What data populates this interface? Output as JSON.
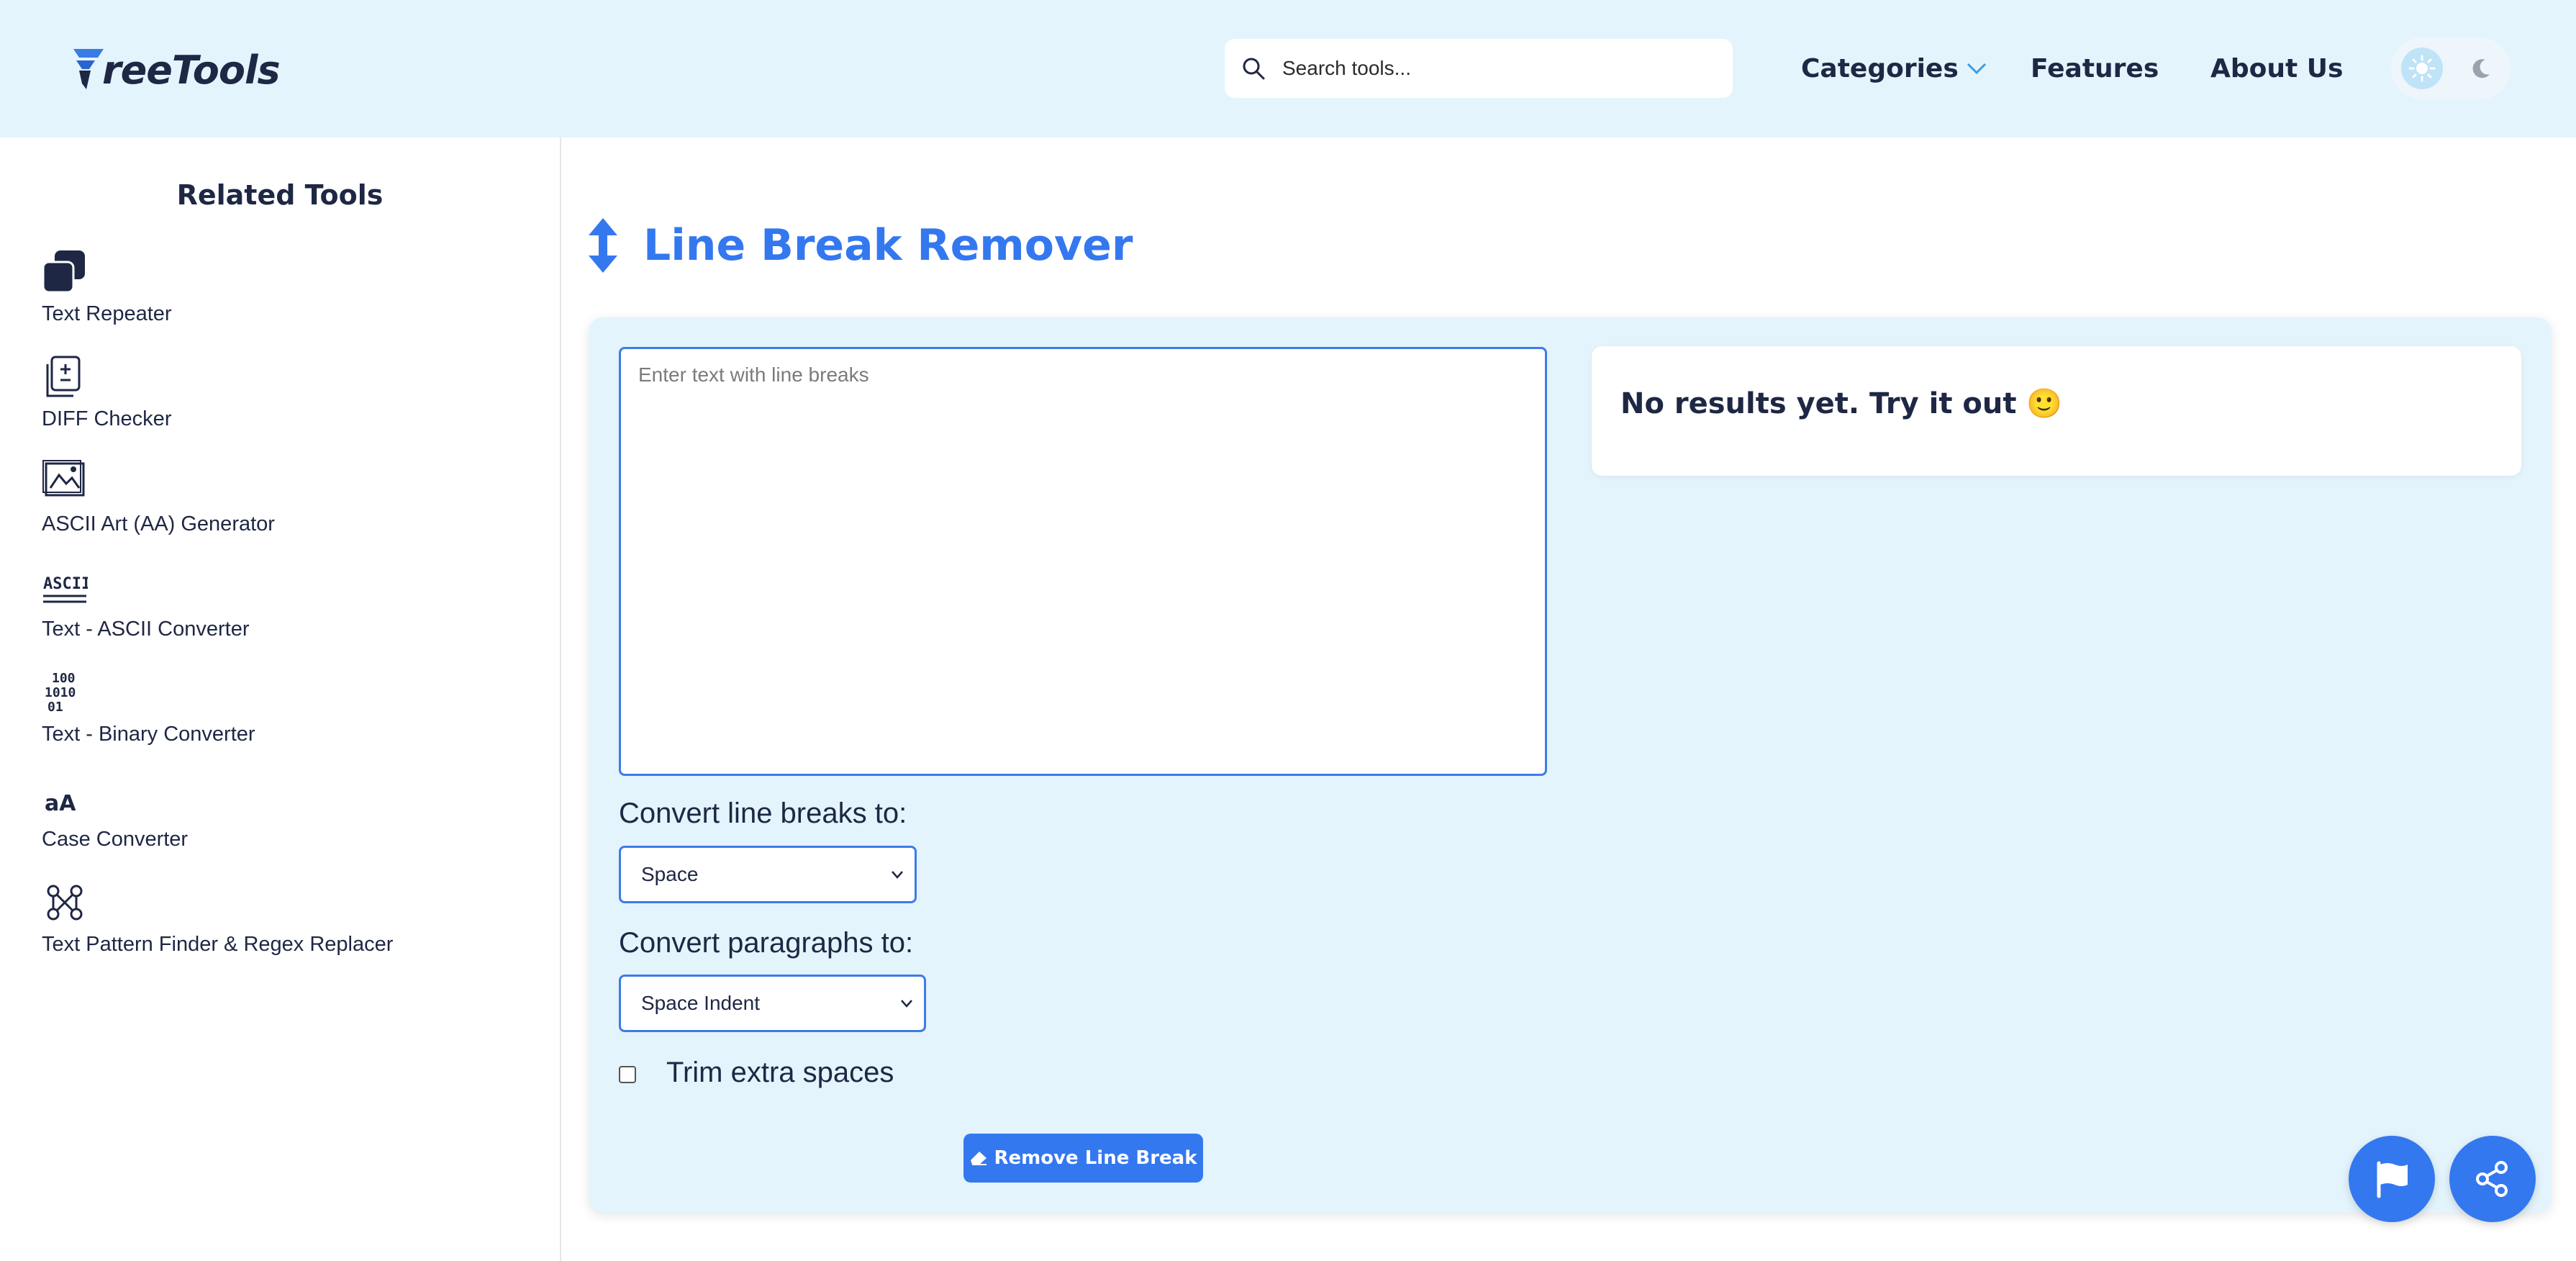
{
  "header": {
    "logo_text": "reeTools",
    "search_placeholder": "Search tools...",
    "nav": {
      "categories": "Categories",
      "features": "Features",
      "about": "About Us"
    }
  },
  "sidebar": {
    "title": "Related Tools",
    "items": [
      {
        "label": "Text Repeater",
        "icon": "copy-icon"
      },
      {
        "label": "DIFF Checker",
        "icon": "diff-document-icon"
      },
      {
        "label": "ASCII Art (AA) Generator",
        "icon": "ascii-art-icon"
      },
      {
        "label": "Text - ASCII Converter",
        "icon": "ascii-icon"
      },
      {
        "label": "Text - Binary Converter",
        "icon": "binary-icon"
      },
      {
        "label": "Case Converter",
        "icon": "case-icon"
      },
      {
        "label": "Text Pattern Finder & Regex Replacer",
        "icon": "regex-pattern-icon"
      }
    ]
  },
  "main": {
    "title": "Line Break Remover",
    "textarea_placeholder": "Enter text with line breaks",
    "line_breaks_label": "Convert line breaks to:",
    "line_breaks_value": "Space",
    "paragraphs_label": "Convert paragraphs to:",
    "paragraphs_value": "Space Indent",
    "trim_label": "Trim extra spaces",
    "trim_checked": false,
    "submit_label": "Remove Line Break",
    "result_text": "No results yet. Try it out 🙂"
  },
  "colors": {
    "accent": "#3478f0",
    "header_bg": "#e3f4fc",
    "text_dark": "#1e2744"
  }
}
